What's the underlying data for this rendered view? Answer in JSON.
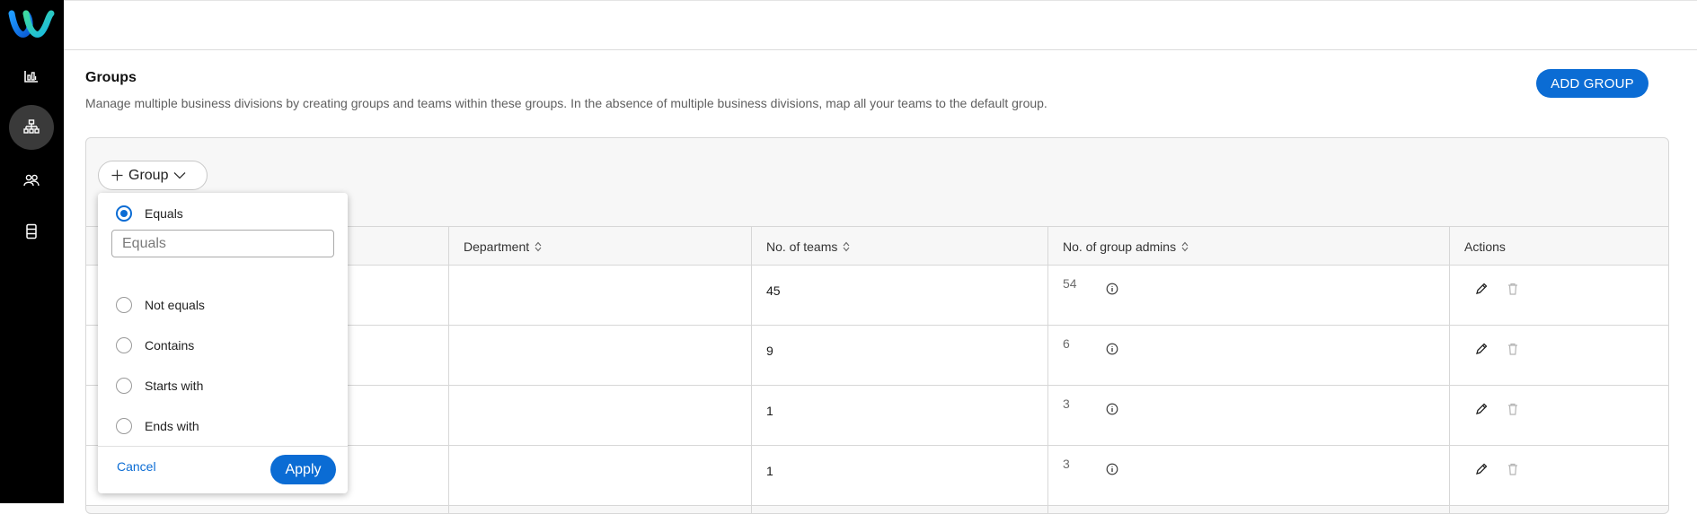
{
  "nav": {
    "items": [
      {
        "icon": "analytics-icon"
      },
      {
        "icon": "org-hierarchy-icon",
        "active": true
      },
      {
        "icon": "users-icon"
      },
      {
        "icon": "database-icon"
      }
    ]
  },
  "page": {
    "title": "Groups",
    "description": "Manage multiple business divisions by creating groups and teams within these groups. In the absence of multiple business divisions, map all your teams to the default group.",
    "add_button": "ADD GROUP"
  },
  "filter": {
    "chip_label": "Group",
    "options": [
      "Equals",
      "Not equals",
      "Contains",
      "Starts with",
      "Ends with"
    ],
    "selected": "Equals",
    "input_placeholder": "Equals",
    "cancel_label": "Cancel",
    "apply_label": "Apply"
  },
  "table": {
    "columns": [
      "Department",
      "No. of teams",
      "No. of group admins",
      "Actions"
    ],
    "rows": [
      {
        "teams": "45",
        "admins": "54"
      },
      {
        "teams": "9",
        "admins": "6"
      },
      {
        "teams": "1",
        "admins": "3"
      },
      {
        "teams": "1",
        "admins": "3"
      }
    ]
  },
  "colors": {
    "accent": "#0b6cd4",
    "rail": "#000000"
  }
}
